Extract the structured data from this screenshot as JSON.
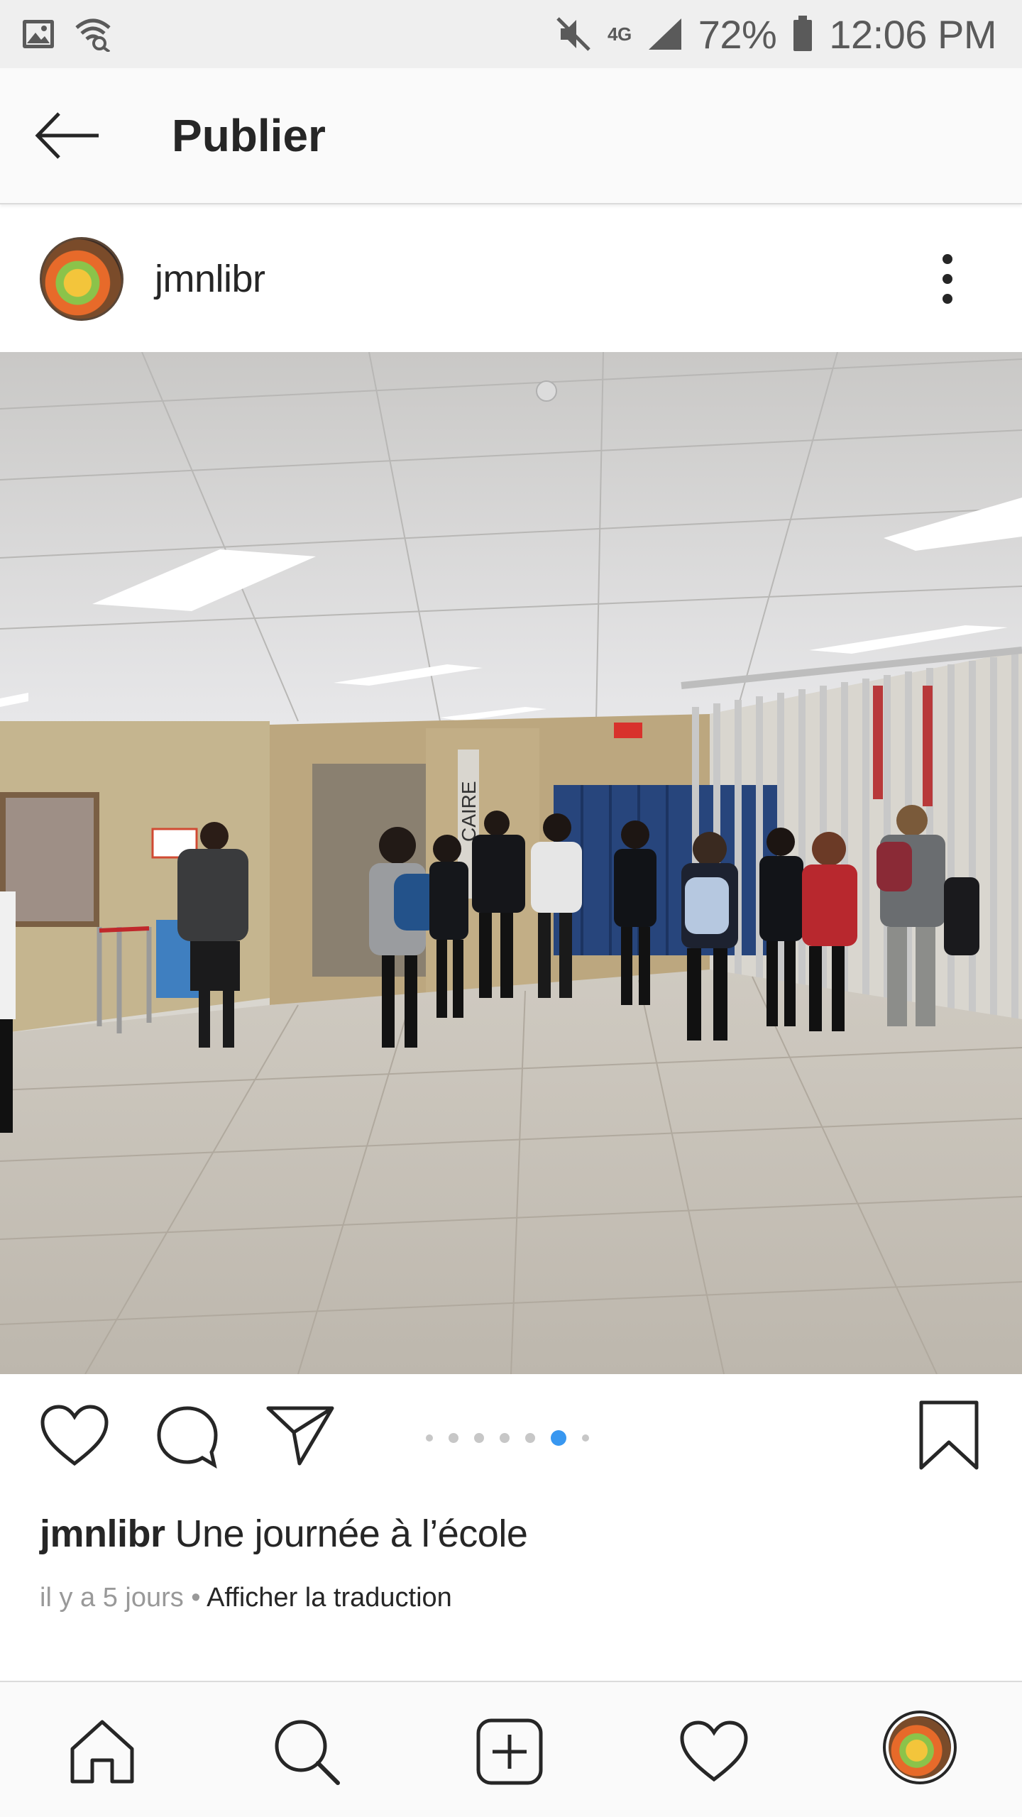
{
  "status_bar": {
    "battery": "72%",
    "time": "12:06 PM",
    "network": "4G"
  },
  "app_bar": {
    "title": "Publier"
  },
  "post": {
    "username": "jmnlibr",
    "caption_user": "jmnlibr",
    "caption_text": "Une journée à l’école",
    "age": "il y a 5 jours",
    "separator": " • ",
    "translate_label": "Afficher la traduction",
    "carousel": {
      "count": 7,
      "active_index": 5
    },
    "sign_text": "CAIRE"
  },
  "colors": {
    "accent": "#3897f0",
    "text": "#262626",
    "muted": "#999999"
  }
}
